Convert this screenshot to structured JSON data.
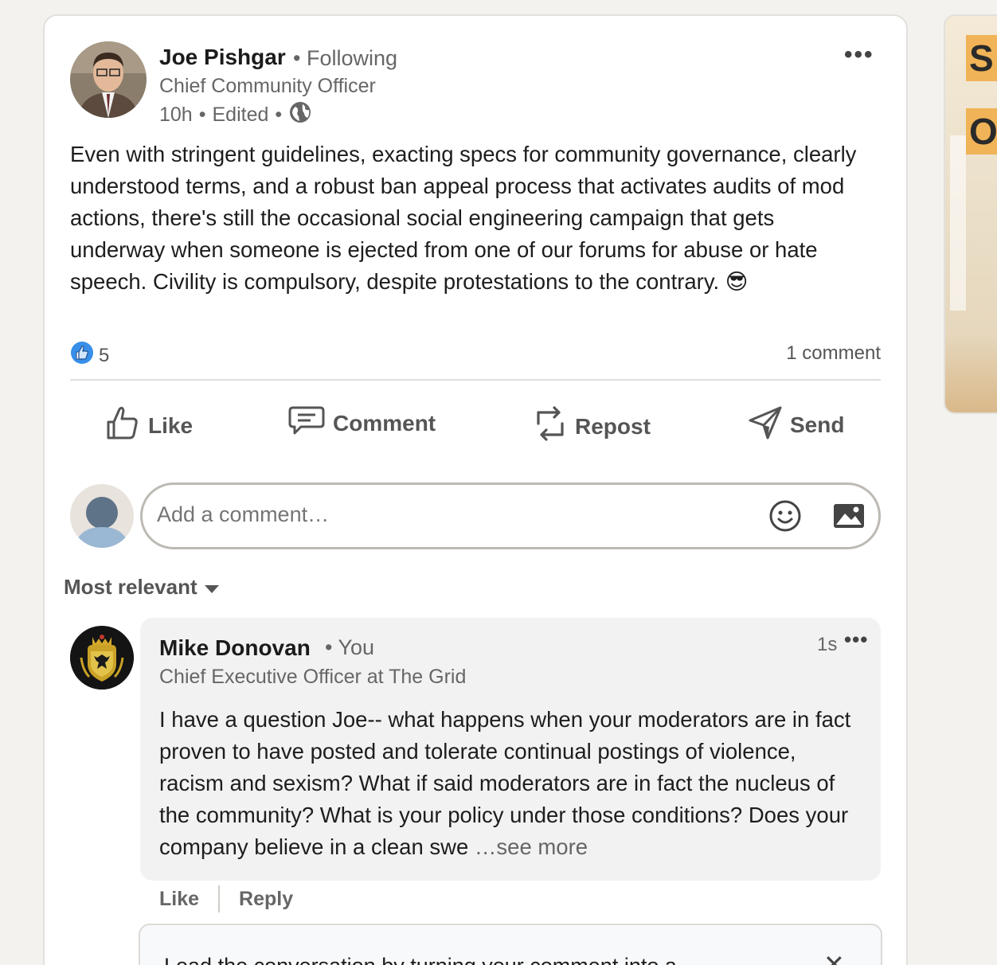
{
  "post": {
    "author_name": "Joe Pishgar",
    "following_label": "• Following",
    "author_title": "Chief Community Officer",
    "time": "10h",
    "edited": "Edited",
    "meta_sep": "•",
    "text": "Even with stringent guidelines, exacting specs for community governance, clearly understood terms, and a robust ban appeal process that activates audits of mod actions, there's still the occasional social engineering campaign that gets underway when someone is ejected from one of our forums for abuse or hate speech. Civility is compulsory, despite protestations to the contrary. 😎",
    "reaction_count": "5",
    "comment_count": "1 comment"
  },
  "actions": {
    "like": "Like",
    "comment": "Comment",
    "repost": "Repost",
    "send": "Send"
  },
  "comment_input": {
    "placeholder": "Add a comment…"
  },
  "sort": {
    "label": "Most relevant"
  },
  "comment": {
    "author_name": "Mike Donovan",
    "you_label": "• You",
    "author_title": "Chief Executive Officer at The Grid",
    "time": "1s",
    "text": "I have a question Joe-- what happens when your moderators are in fact proven to have posted and tolerate continual postings of violence, racism and sexism? What if said moderators are in fact the nucleus of the community? What is your policy under those conditions? Does your company believe in a clean swe",
    "see_more": "…see more",
    "like": "Like",
    "reply": "Reply"
  },
  "promo": {
    "text": "Lead the conversation by turning your comment into a"
  },
  "side_ad": {
    "letter1": "S",
    "letter2": "O"
  },
  "colors": {
    "like_blue": "#378fe9",
    "text_secondary": "#666666",
    "card_bg": "#ffffff",
    "page_bg": "#f3f2ef"
  }
}
